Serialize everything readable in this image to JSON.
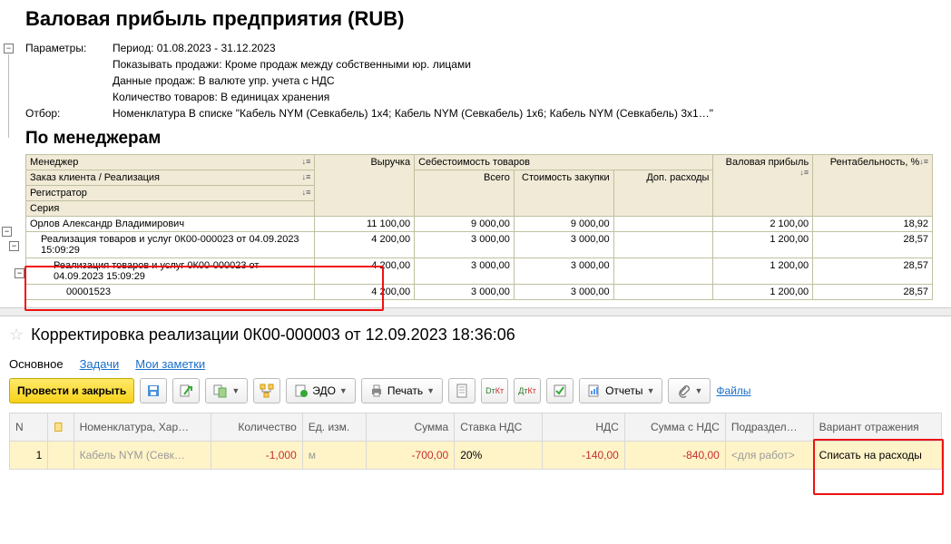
{
  "report": {
    "title": "Валовая прибыль предприятия (RUB)",
    "params_label": "Параметры:",
    "filter_label": "Отбор:",
    "params": {
      "period": "Период: 01.08.2023 - 31.12.2023",
      "show_sales": "Показывать продажи: Кроме продаж между собственными юр. лицами",
      "sales_data": "Данные продаж: В валюте упр. учета с НДС",
      "qty": "Количество товаров: В единицах хранения"
    },
    "filter": "Номенклатура В списке \"Кабель NYM (Севкабель) 1x4; Кабель NYM (Севкабель) 1x6; Кабель NYM (Севкабель) 3x1…\"",
    "section_title": "По менеджерам",
    "headers": {
      "manager": "Менеджер",
      "order": "Заказ клиента / Реализация",
      "registrar": "Регистратор",
      "series": "Серия",
      "revenue": "Выручка",
      "cost_group": "Себестоимость товаров",
      "cost_total": "Всего",
      "cost_purchase": "Стоимость закупки",
      "cost_extra": "Доп. расходы",
      "gross": "Валовая прибыль",
      "rent": "Рентабельность, %"
    },
    "rows": [
      {
        "level": 1,
        "name": "Орлов Александр Владимирович",
        "rev": "11 100,00",
        "c1": "9 000,00",
        "c2": "9 000,00",
        "c3": "",
        "gp": "2 100,00",
        "r": "18,92"
      },
      {
        "level": 2,
        "name": "Реализация товаров и услуг 0К00-000023 от 04.09.2023 15:09:29",
        "rev": "4 200,00",
        "c1": "3 000,00",
        "c2": "3 000,00",
        "c3": "",
        "gp": "1 200,00",
        "r": "28,57"
      },
      {
        "level": 3,
        "name": "Реализация товаров и услуг 0К00-000023 от 04.09.2023 15:09:29",
        "rev": "4 200,00",
        "c1": "3 000,00",
        "c2": "3 000,00",
        "c3": "",
        "gp": "1 200,00",
        "r": "28,57"
      },
      {
        "level": 4,
        "name": "00001523",
        "rev": "4 200,00",
        "c1": "3 000,00",
        "c2": "3 000,00",
        "c3": "",
        "gp": "1 200,00",
        "r": "28,57"
      }
    ]
  },
  "doc": {
    "title": "Корректировка реализации 0К00-000003 от 12.09.2023 18:36:06",
    "tabs": {
      "main": "Основное",
      "tasks": "Задачи",
      "notes": "Мои заметки"
    },
    "toolbar": {
      "post_close": "Провести и закрыть",
      "edo": "ЭДО",
      "print": "Печать",
      "reports": "Отчеты",
      "files": "Файлы"
    },
    "grid_headers": {
      "n": "N",
      "lock": "",
      "nomen": "Номенклатура, Хар…",
      "qty": "Количество",
      "unit": "Ед. изм.",
      "sum": "Сумма",
      "vat_rate": "Ставка НДС",
      "vat": "НДС",
      "sum_vat": "Сумма с НДС",
      "dept": "Подраздел…",
      "variant": "Вариант отражения"
    },
    "row": {
      "n": "1",
      "nomen": "Кабель NYM (Севк…",
      "qty": "-1,000",
      "unit": "м",
      "sum": "-700,00",
      "vat_rate": "20%",
      "vat": "-140,00",
      "sum_vat": "-840,00",
      "dept": "<для работ>",
      "variant": "Списать на расходы"
    }
  }
}
